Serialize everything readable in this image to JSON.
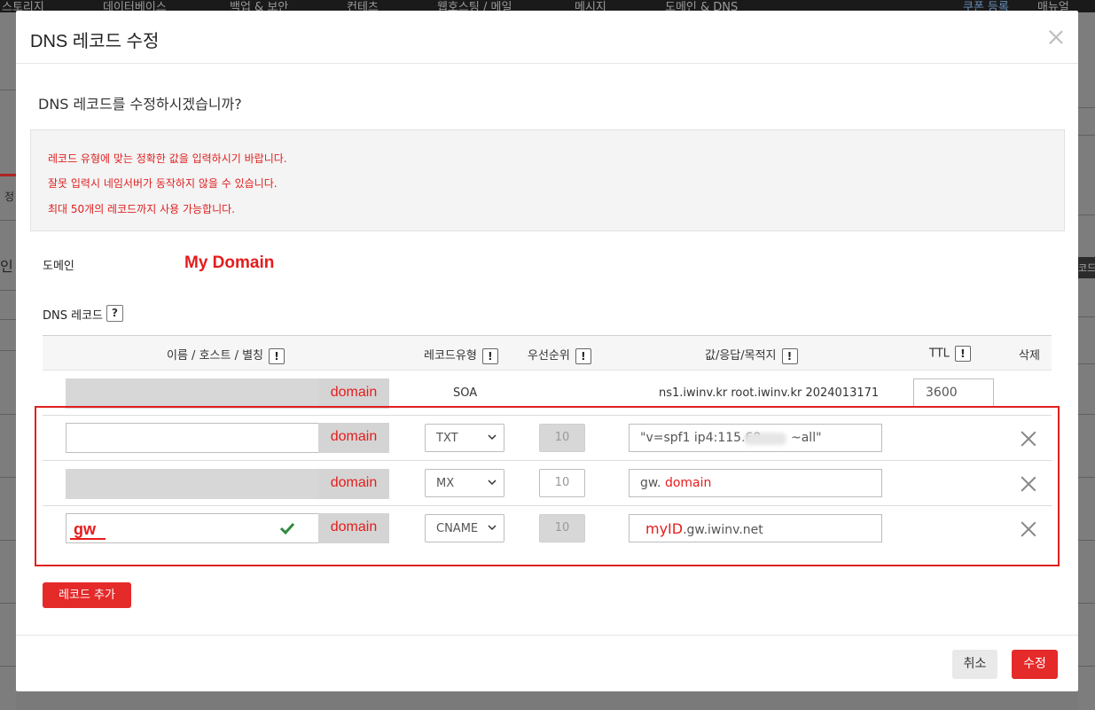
{
  "background": {
    "nav_items": [
      "스토리지",
      "데이터베이스",
      "백업 & 보안",
      "컨테츠",
      "웹호스팅 / 메일",
      "메시지",
      "도메인 & DNS",
      "쿠폰 등록",
      "매뉴얼"
    ],
    "side_texts": [
      "정",
      "인",
      "코드"
    ]
  },
  "modal": {
    "title": "DNS 레코드 수정",
    "question": "DNS 레코드를 수정하시겠습니까?",
    "notices": [
      "레코드 유형에 맞는 정확한 값을 입력하시기 바랍니다.",
      "잘못 입력시 네임서버가 동작하지 않을 수 있습니다.",
      "최대 50개의 레코드까지 사용 가능합니다."
    ],
    "domain_label": "도메인",
    "domain_value": "My Domain",
    "dns_label": "DNS 레코드",
    "help_glyph": "?",
    "excl_glyph": "!",
    "columns": {
      "name": "이름 / 호스트 / 별칭",
      "type": "레코드유형",
      "priority": "우선순위",
      "value": "값/응답/목적지",
      "ttl": "TTL",
      "delete": "삭제"
    },
    "soa_row": {
      "host": "",
      "domain_suffix": "domain",
      "type": "SOA",
      "value": "ns1.iwinv.kr root.iwinv.kr 2024013171",
      "ttl": "3600"
    },
    "rows": [
      {
        "host": "",
        "domain_suffix": "domain",
        "type": "TXT",
        "priority": "10",
        "value": "\"v=spf1 ip4:115.68.",
        "value_tail": "~all\""
      },
      {
        "host": "",
        "domain_suffix": "domain",
        "type": "MX",
        "priority": "10",
        "value": "gw.",
        "value_highlight": "domain"
      },
      {
        "host": "gw",
        "domain_suffix": "domain",
        "type": "CNAME",
        "priority": "10",
        "value_highlight": "myID",
        "value": ".gw.iwinv.net"
      }
    ],
    "add_button": "레코드 추가",
    "cancel_button": "취소",
    "submit_button": "수정"
  },
  "colors": {
    "accent": "#e52a2a",
    "alert_text": "#e02020"
  }
}
